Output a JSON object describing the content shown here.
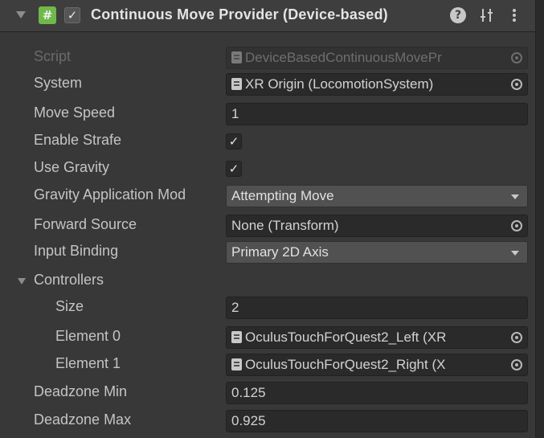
{
  "component": {
    "title": "Continuous Move Provider (Device-based)",
    "script_icon": "#",
    "enabled_check": "✓",
    "help_icon": "?",
    "icons": [
      "fold-arrow-icon",
      "script-icon",
      "enable-checkbox",
      "help-icon",
      "preset-icon",
      "context-menu-icon"
    ]
  },
  "fields": {
    "script": {
      "label": "Script",
      "value": "DeviceBasedContinuousMovePr"
    },
    "system": {
      "label": "System",
      "value": "XR Origin (LocomotionSystem)"
    },
    "move_speed": {
      "label": "Move Speed",
      "value": "1"
    },
    "enable_strafe": {
      "label": "Enable Strafe",
      "check": "✓"
    },
    "use_gravity": {
      "label": "Use Gravity",
      "check": "✓"
    },
    "gravity_mode": {
      "label": "Gravity Application Mod",
      "value": "Attempting Move"
    },
    "forward_source": {
      "label": "Forward Source",
      "value": "None (Transform)"
    },
    "input_binding": {
      "label": "Input Binding",
      "value": "Primary 2D Axis"
    },
    "controllers": {
      "label": "Controllers",
      "size_label": "Size",
      "size_value": "2",
      "elements": [
        {
          "label": "Element 0",
          "value": "OculusTouchForQuest2_Left (XR"
        },
        {
          "label": "Element 1",
          "value": "OculusTouchForQuest2_Right (X"
        }
      ]
    },
    "deadzone_min": {
      "label": "Deadzone Min",
      "value": "0.125"
    },
    "deadzone_max": {
      "label": "Deadzone Max",
      "value": "0.925"
    }
  },
  "colors": {
    "panel_bg": "#383838",
    "field_bg": "#2a2a2a",
    "dropdown_bg": "#515151",
    "script_icon": "#6fb84a",
    "text": "#c4c4c4",
    "disabled_text": "#6a6a6a"
  }
}
